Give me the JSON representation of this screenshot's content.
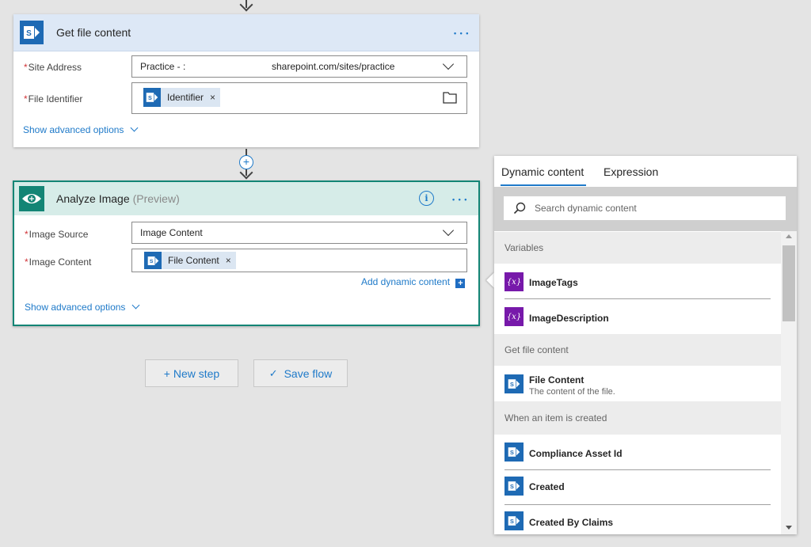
{
  "get_file_content": {
    "title": "Get file content",
    "more": "• • •",
    "site_address_label": "Site Address",
    "site_address_prefix": "Practice - :",
    "site_address_value": "sharepoint.com/sites/practice",
    "file_identifier_label": "File Identifier",
    "file_identifier_token": "Identifier",
    "advanced": "Show advanced options"
  },
  "analyze_image": {
    "title": "Analyze Image",
    "preview": "(Preview)",
    "more": "• • •",
    "image_source_label": "Image Source",
    "image_source_value": "Image Content",
    "image_content_label": "Image Content",
    "image_content_token": "File Content",
    "add_dynamic": "Add dynamic content",
    "advanced": "Show advanced options"
  },
  "actions": {
    "new_step": "+ New step",
    "save_flow": "Save flow"
  },
  "panel": {
    "tabs": [
      "Dynamic content",
      "Expression"
    ],
    "search_placeholder": "Search dynamic content",
    "sections": {
      "variables": "Variables",
      "get_file": "Get file content",
      "when_created": "When an item is created"
    },
    "variables": [
      "ImageTags",
      "ImageDescription"
    ],
    "file_content": {
      "title": "File Content",
      "desc": "The content of the file."
    },
    "item_fields": [
      "Compliance Asset Id",
      "Created",
      "Created By Claims"
    ],
    "var_icon": "{x}"
  },
  "colors": {
    "sharepoint_blue": "#1e6ab4",
    "analyze_teal": "#138575",
    "link_blue": "#1f7ac9",
    "variable_purple": "#7719aa"
  }
}
